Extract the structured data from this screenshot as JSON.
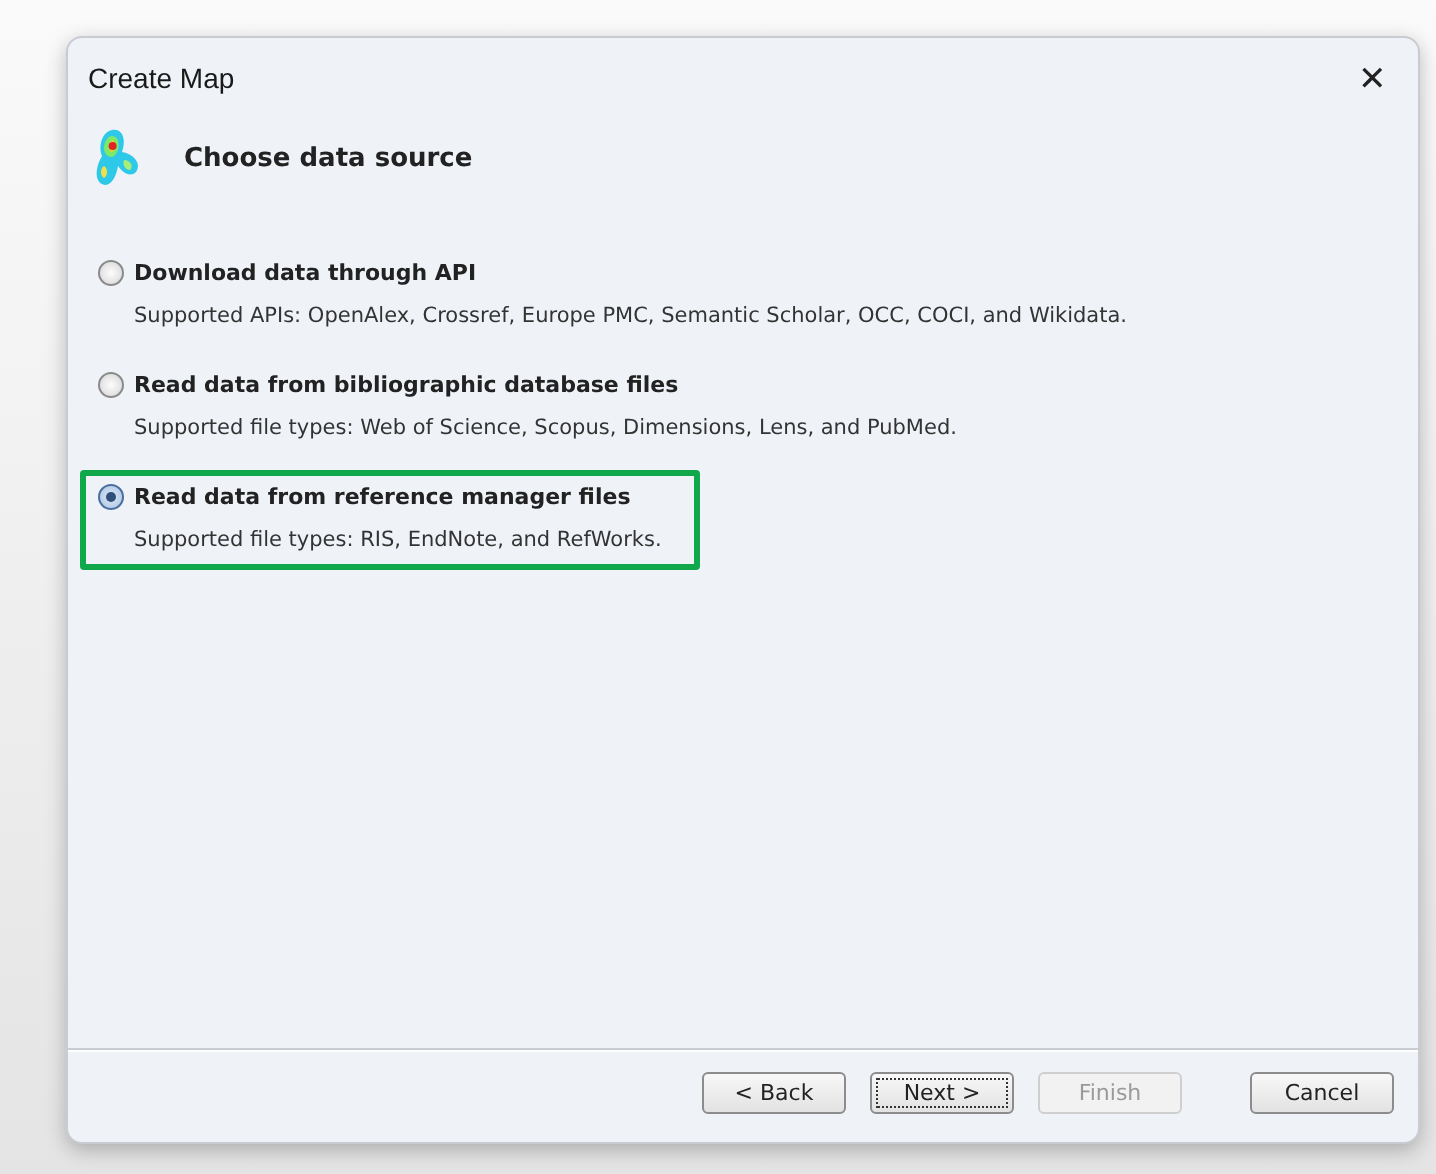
{
  "window": {
    "title": "Create Map",
    "close": "✕"
  },
  "header": {
    "title": "Choose data source"
  },
  "options": [
    {
      "label": "Download data through API",
      "description": "Supported APIs: OpenAlex, Crossref, Europe PMC, Semantic Scholar, OCC, COCI, and Wikidata.",
      "selected": false,
      "highlighted": false
    },
    {
      "label": "Read data from bibliographic database files",
      "description": "Supported file types: Web of Science, Scopus, Dimensions, Lens, and PubMed.",
      "selected": false,
      "highlighted": false
    },
    {
      "label": "Read data from reference manager files",
      "description": "Supported file types: RIS, EndNote, and RefWorks.",
      "selected": true,
      "highlighted": true
    }
  ],
  "buttons": [
    {
      "label": "< Back",
      "disabled": false,
      "focused": false
    },
    {
      "label": "Next >",
      "disabled": false,
      "focused": true
    },
    {
      "label": "Finish",
      "disabled": true,
      "focused": false
    },
    {
      "label": "Cancel",
      "disabled": false,
      "focused": false
    }
  ]
}
